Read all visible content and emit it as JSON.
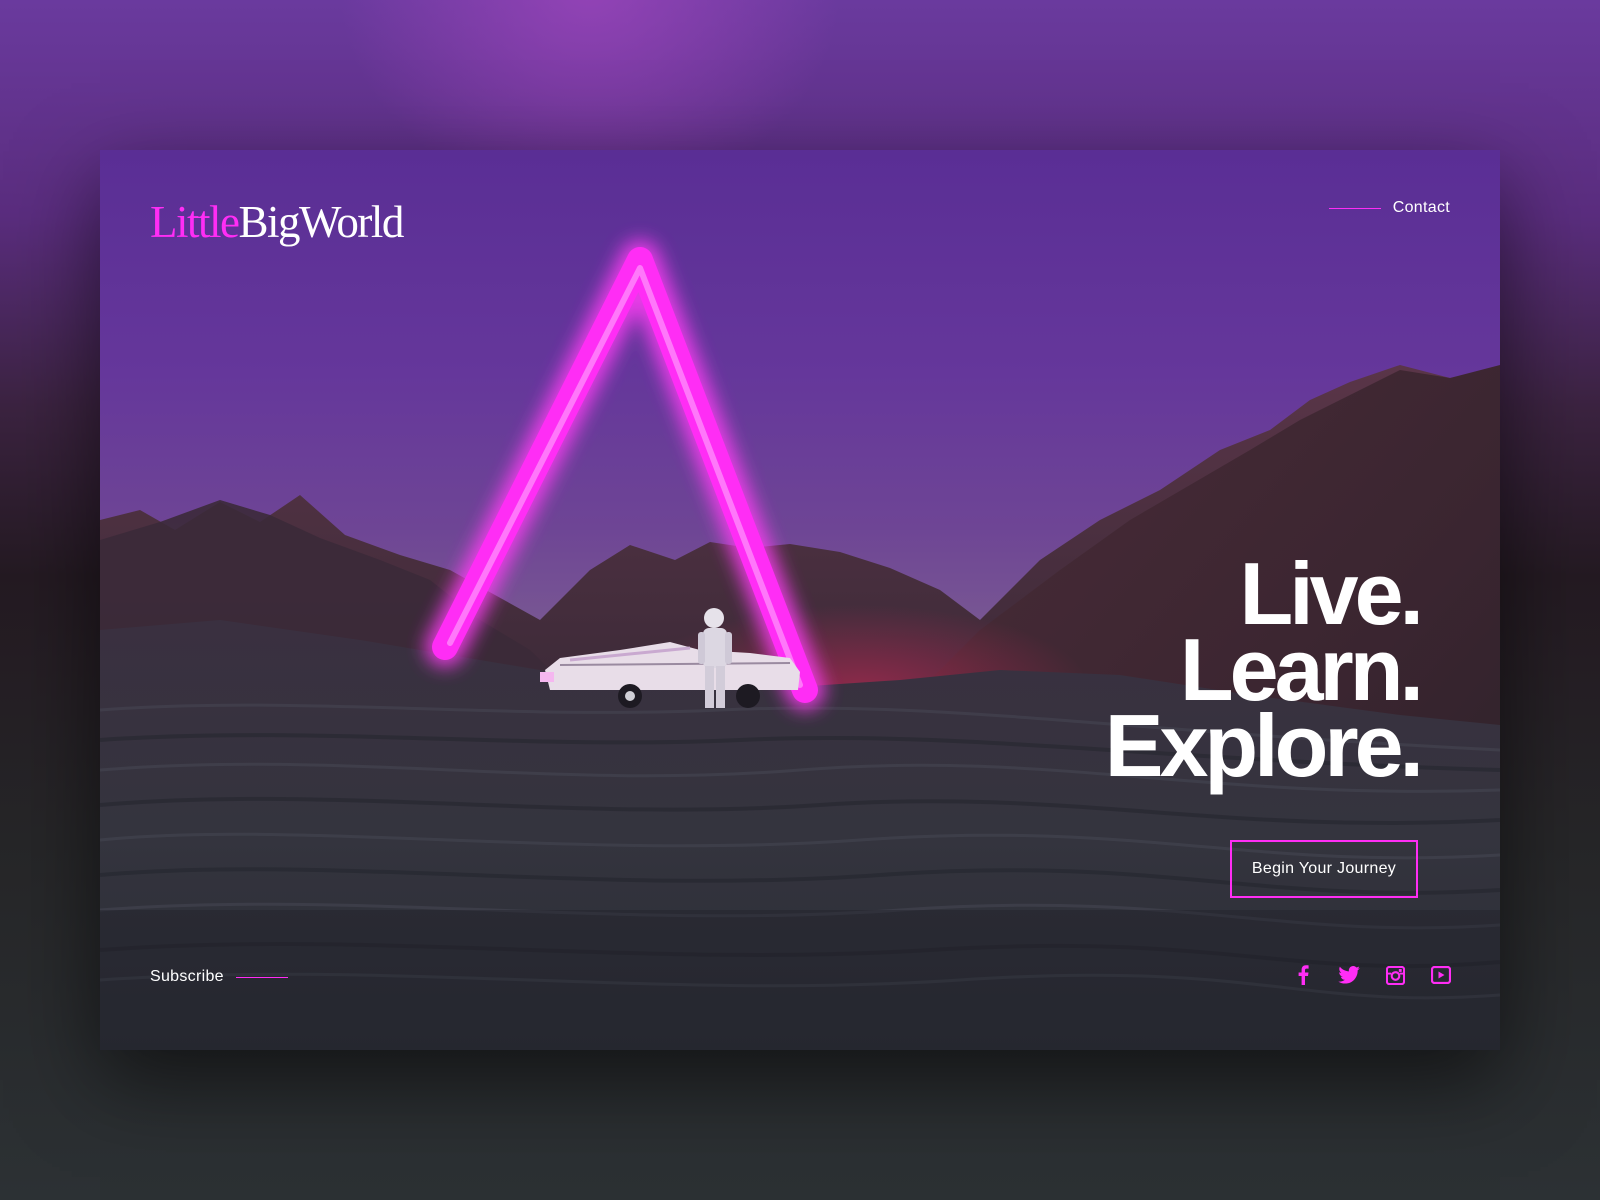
{
  "brand": {
    "part1": "Little",
    "part2": "BigWorld",
    "accent_color": "#ff2df5"
  },
  "nav": {
    "contact_label": "Contact"
  },
  "hero": {
    "lines": [
      "Live.",
      "Learn.",
      "Explore."
    ],
    "cta_label": "Begin Your Journey",
    "image_subject": "neon pink triangle arch over astronaut beside white convertible in purple mountain landscape"
  },
  "footer": {
    "subscribe_label": "Subscribe"
  },
  "social": [
    {
      "icon": "facebook-icon"
    },
    {
      "icon": "twitter-icon"
    },
    {
      "icon": "instagram-icon"
    },
    {
      "icon": "youtube-icon"
    }
  ],
  "colors": {
    "accent": "#ff2df5",
    "text": "#ffffff",
    "sky_top": "#5a2e95"
  }
}
